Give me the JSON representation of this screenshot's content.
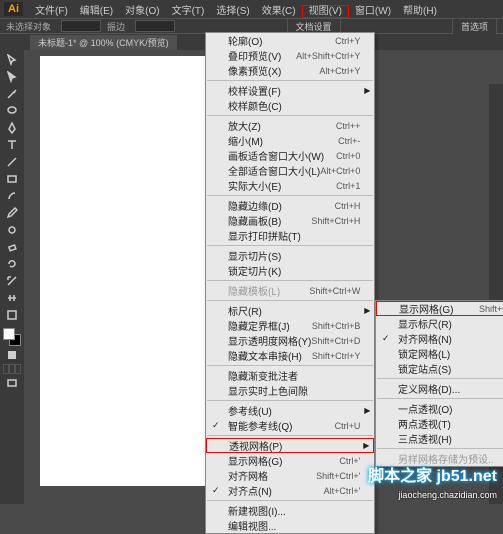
{
  "menubar": {
    "items": [
      "文件(F)",
      "编辑(E)",
      "对象(O)",
      "文字(T)",
      "选择(S)",
      "效果(C)",
      "视图(V)",
      "窗口(W)",
      "帮助(H)"
    ],
    "highlight_index": 6
  },
  "controlbar": {
    "noselect": "未选择对象",
    "tag": "振边",
    "btn_docsetup": "文档设置",
    "btn_pref": "首选项"
  },
  "tab": {
    "label": "未标题-1* @ 100% (CMYK/预览)"
  },
  "menu1": [
    {
      "t": "轮廓(O)",
      "k": "Ctrl+Y"
    },
    {
      "t": "叠印预览(V)",
      "k": "Alt+Shift+Ctrl+Y"
    },
    {
      "t": "像素预览(X)",
      "k": "Alt+Ctrl+Y"
    },
    {
      "sep": true
    },
    {
      "t": "校样设置(F)",
      "sub": true
    },
    {
      "t": "校样颜色(C)"
    },
    {
      "sep": true
    },
    {
      "t": "放大(Z)",
      "k": "Ctrl++"
    },
    {
      "t": "缩小(M)",
      "k": "Ctrl+-"
    },
    {
      "t": "画板适合窗口大小(W)",
      "k": "Ctrl+0"
    },
    {
      "t": "全部适合窗口大小(L)",
      "k": "Alt+Ctrl+0"
    },
    {
      "t": "实际大小(E)",
      "k": "Ctrl+1"
    },
    {
      "sep": true
    },
    {
      "t": "隐藏边缘(D)",
      "k": "Ctrl+H"
    },
    {
      "t": "隐藏画板(B)",
      "k": "Shift+Ctrl+H"
    },
    {
      "t": "显示打印拼贴(T)"
    },
    {
      "sep": true
    },
    {
      "t": "显示切片(S)"
    },
    {
      "t": "锁定切片(K)"
    },
    {
      "sep": true
    },
    {
      "t": "隐藏模板(L)",
      "k": "Shift+Ctrl+W",
      "dis": true
    },
    {
      "sep": true
    },
    {
      "t": "标尺(R)",
      "sub": true
    },
    {
      "t": "隐藏定界框(J)",
      "k": "Shift+Ctrl+B"
    },
    {
      "t": "显示透明度网格(Y)",
      "k": "Shift+Ctrl+D"
    },
    {
      "t": "隐藏文本串接(H)",
      "k": "Shift+Ctrl+Y"
    },
    {
      "sep": true
    },
    {
      "t": "隐藏渐变批注者"
    },
    {
      "t": "显示实时上色间隙"
    },
    {
      "sep": true
    },
    {
      "t": "参考线(U)",
      "sub": true
    },
    {
      "t": "智能参考线(Q)",
      "k": "Ctrl+U",
      "chk": true
    },
    {
      "sep": true
    },
    {
      "t": "透视网格(P)",
      "sub": true,
      "hl": true
    },
    {
      "t": "显示网格(G)",
      "k": "Ctrl+'"
    },
    {
      "t": "对齐网格",
      "k": "Shift+Ctrl+'"
    },
    {
      "t": "对齐点(N)",
      "k": "Alt+Ctrl+'",
      "chk": true
    },
    {
      "sep": true
    },
    {
      "t": "新建视图(I)..."
    },
    {
      "t": "编辑视图..."
    }
  ],
  "menu2": [
    {
      "t": "显示网格(G)",
      "k": "Shift+Ctrl+I",
      "hl": true
    },
    {
      "t": "显示标尺(R)"
    },
    {
      "t": "对齐网格(N)",
      "chk": true
    },
    {
      "t": "锁定网格(L)"
    },
    {
      "t": "锁定站点(S)"
    },
    {
      "sep": true
    },
    {
      "t": "定义网格(D)..."
    },
    {
      "sep": true
    },
    {
      "t": "一点透视(O)"
    },
    {
      "t": "两点透视(T)"
    },
    {
      "t": "三点透视(H)"
    },
    {
      "sep": true
    },
    {
      "t": "另样网格存储为预设..",
      "dis": true
    }
  ],
  "watermark": {
    "main": "脚本之家 jb51.net",
    "sub": "jiaocheng.chazidian.com"
  }
}
